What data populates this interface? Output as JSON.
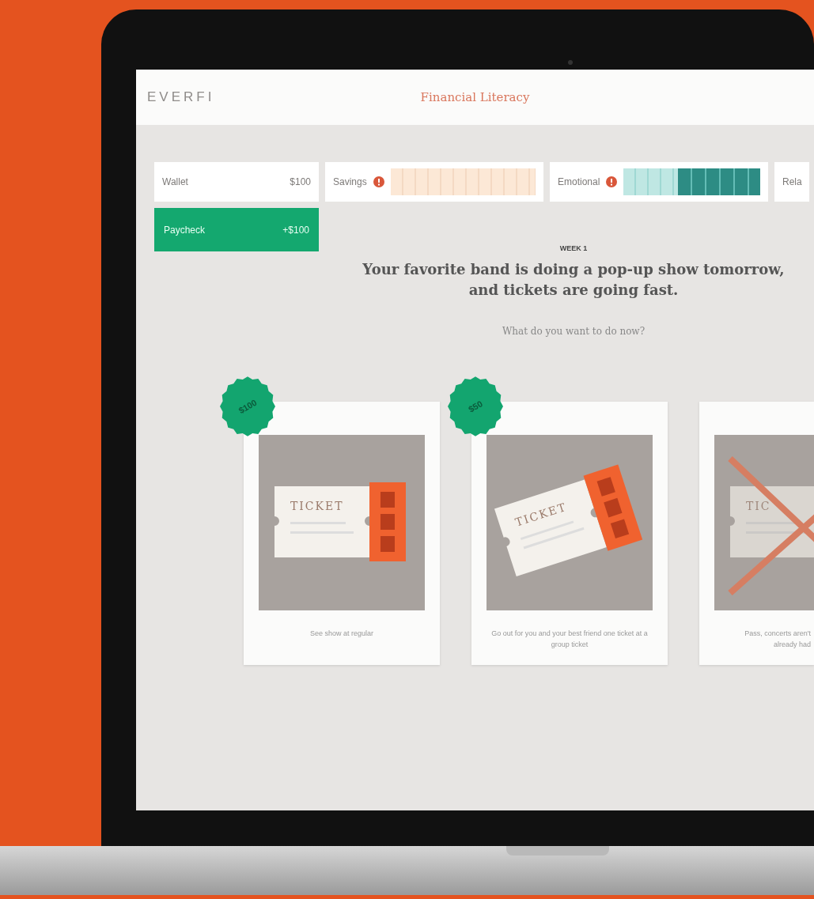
{
  "app": {
    "logo": "EVERFI",
    "title": "Financial Literacy"
  },
  "stats": [
    {
      "kind": "value",
      "label": "Wallet",
      "value": "$100",
      "help": false
    },
    {
      "kind": "meter",
      "label": "Savings",
      "level": 0,
      "help": true
    },
    {
      "kind": "meter",
      "label": "Emotional",
      "level": 0.6,
      "help": true
    },
    {
      "kind": "label",
      "label": "Rela",
      "help": false
    }
  ],
  "paycheck": {
    "label": "Paycheck",
    "value": "+$100"
  },
  "scenario": {
    "week": "WEEK 1",
    "heading": "Your favorite band is doing a pop-up show tomorrow, and tickets are going fast.",
    "question": "What do you want to do now?"
  },
  "choices": [
    {
      "price": "$100",
      "ticket_text": "TICKET",
      "kind": "upright",
      "crossed": false,
      "caption": "See show at regular"
    },
    {
      "price": "$50",
      "ticket_text": "TICKET",
      "kind": "tilted",
      "crossed": false,
      "caption": "Go out for you and your best friend one ticket at a group ticket"
    },
    {
      "ticket_text": "TIC",
      "kind": "upright",
      "crossed": true,
      "caption": "Pass, concerts aren't",
      "caption_2": "already had"
    }
  ]
}
